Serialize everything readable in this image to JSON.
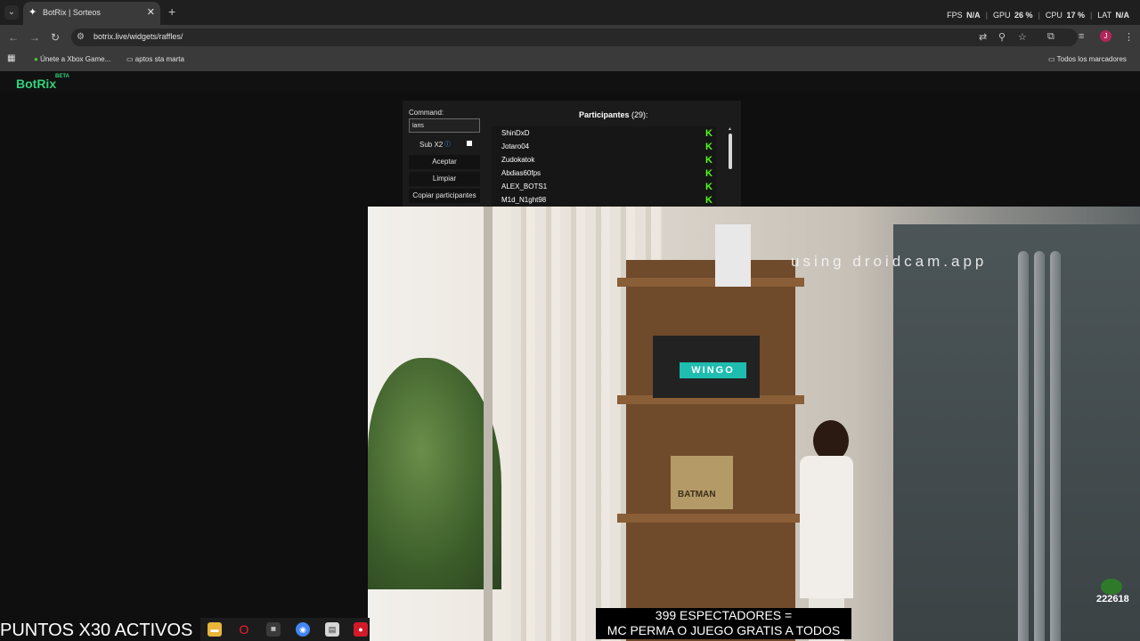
{
  "browser": {
    "tab_title": "BotRix | Sorteos",
    "url": "botrix.live/widgets/raffles/",
    "bookmarks": [
      "Únete a Xbox Game...",
      "aptos sta marta"
    ],
    "bookmarks_right": "Todos los marcadores",
    "profile_initial": "J"
  },
  "stats": {
    "fps_label": "FPS",
    "fps_value": "N/A",
    "gpu_label": "GPU",
    "gpu_value": "26 %",
    "cpu_label": "CPU",
    "cpu_value": "17 %",
    "lat_label": "LAT",
    "lat_value": "N/A"
  },
  "site": {
    "logo": "BotRix",
    "beta": "BETA"
  },
  "raffle": {
    "command_label": "Command:",
    "command_value": "laris",
    "sub_label": "Sub X2",
    "accept": "Aceptar",
    "clear": "Limpiar",
    "copy": "Copiar participantes",
    "participants_title": "Participantes",
    "participants_count": "(29):",
    "participants": [
      "ShinDxD",
      "Jotaro04",
      "Zudokatok",
      "Abdias60fps",
      "ALEX_BOTS1",
      "M1d_N1ght98"
    ]
  },
  "stream": {
    "watermark": "using droidcam.app",
    "caption_line1": "399 ESPECTADORES =",
    "caption_line2": "MC PERMA O JUEGO GRATIS A TODOS",
    "counter": "222618",
    "points_banner": "PUNTOS X30 ACTIVOS",
    "wingo": "WINGO",
    "batman": "BATMAN"
  },
  "colors": {
    "brand": "#33d17a",
    "kick": "#53fc18",
    "accent": "#1fbcb0"
  }
}
